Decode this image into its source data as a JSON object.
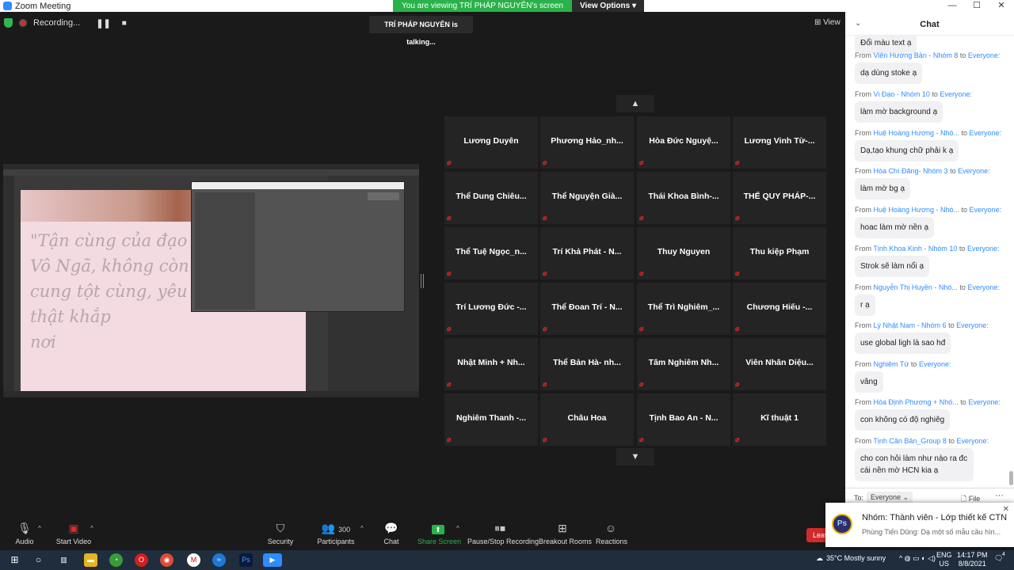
{
  "window": {
    "title": "Zoom Meeting"
  },
  "meeting": {
    "recording_label": "Recording...",
    "share_banner": "You are viewing TRÍ PHÁP NGUYÊN's screen",
    "view_options_label": "View Options",
    "talking_label": "TRÍ PHÁP NGUYÊN is talking...",
    "view_label": "View"
  },
  "shared_screen": {
    "quote_lines": [
      "\"Tận cùng của đạo đức",
      "Vô Ngã, không còn cá",
      "cung tột cùng, yêu thương chân thật khắp",
      "nơi"
    ]
  },
  "participants": [
    "Lương Duyên",
    "Phương  Hảo_nh...",
    "Hòa Đức Nguyệ...",
    "Lương Vinh Từ-...",
    "Thể Dung Chiêu...",
    "Thể Nguyện Già...",
    "Thái Khoa Bình-...",
    "THỂ QUY PHÁP-...",
    "Thể Tuệ Ngọc_n...",
    "Trí Khả Phát - N...",
    "Thuy Nguyen",
    "Thu kiệp Phạm",
    "Trí Lương Đức -...",
    "Thể Đoan Trí - N...",
    "Thể Trì Nghiêm_...",
    "Chương Hiếu -...",
    "Nhật Minh + Nh...",
    "Thể Bản Hà- nh...",
    "Tâm Nghiêm Nh...",
    "Viên Nhân Diệu...",
    "Nghiêm Thanh -...",
    "Châu Hoa",
    "Tịnh Bao An - N...",
    "Kĩ thuật 1"
  ],
  "chat": {
    "title": "Chat",
    "partial_top": "Đổi màu text ạ",
    "from_label": "From",
    "to_label": "to",
    "messages": [
      {
        "sender": "Viên Hương Bản - Nhóm 8",
        "to": "Everyone:",
        "text": "dạ dùng stoke ạ"
      },
      {
        "sender": "Vi Đạo - Nhóm 10",
        "to": "Everyone:",
        "text": "làm mờ background ạ"
      },
      {
        "sender": "Huệ Hoàng Hương - Nhó...",
        "to": "Everyone:",
        "text": "Dạ,tạo khung chữ phải k ạ"
      },
      {
        "sender": "Hòa Chí Đăng- Nhóm 3",
        "to": "Everyone:",
        "text": "làm mờ bg ạ"
      },
      {
        "sender": "Huệ Hoàng Hương - Nhó...",
        "to": "Everyone:",
        "text": "hoac làm mờ nền ạ"
      },
      {
        "sender": "Tịnh Khoa Kinh - Nhóm 10",
        "to": "Everyone:",
        "text": "Strok sẽ làm nổi ạ"
      },
      {
        "sender": "Nguyễn Thị Huyền - Nhó...",
        "to": "Everyone:",
        "text": "r ạ"
      },
      {
        "sender": "Lý Nhật Nam - Nhóm 6",
        "to": "Everyone:",
        "text": "use global ligh là sao hđ"
      },
      {
        "sender": "Nghiêm Từ",
        "to": "Everyone:",
        "text": "vâng"
      },
      {
        "sender": "Hòa Định Phương + Nhó...",
        "to": "Everyone:",
        "text": "con không có độ nghiêg"
      },
      {
        "sender": "Tịnh Cần Bản_Group 8",
        "to": "Everyone:",
        "text": "cho con hỏi làm như nào ra đc cái nền mờ HCN kia ạ"
      }
    ],
    "footer": {
      "to": "To:",
      "recipient": "Everyone",
      "file": "File",
      "more": "···"
    }
  },
  "toolbar": {
    "audio": "Audio",
    "start_video": "Start Video",
    "security": "Security",
    "participants": "Participants",
    "participants_count": "300",
    "chat": "Chat",
    "share_screen": "Share Screen",
    "pause_recording": "Pause/Stop Recording",
    "breakout": "Breakout Rooms",
    "reactions": "Reactions",
    "leave": "Leave"
  },
  "notification": {
    "title": "Nhóm: Thành viên - Lớp thiết kế CTN",
    "body": "Phùng Tiến Dũng: Dạ một số mẫu cầu hìn...",
    "app_label": "Ps"
  },
  "taskbar": {
    "weather": "35°C  Mostly sunny",
    "lang": "ENG",
    "region": "US",
    "time": "14:17 PM",
    "date": "8/8/2021",
    "notif_count": "4"
  },
  "colors": {
    "zoom_blue": "#2d8cff",
    "share_green": "#2ab24a",
    "mute_red": "#e02828"
  }
}
